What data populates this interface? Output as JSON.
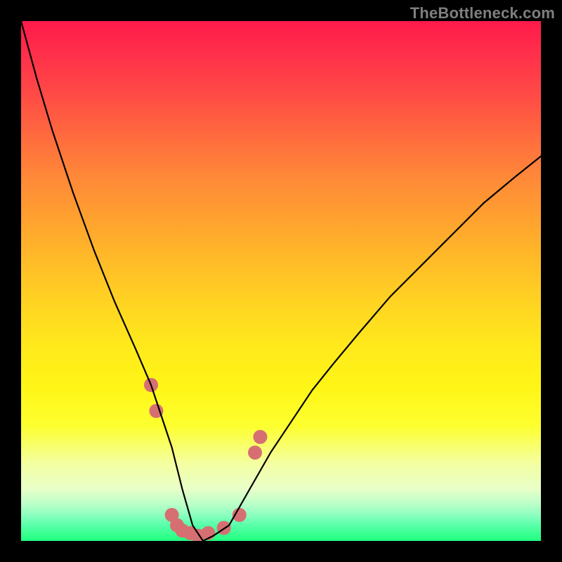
{
  "watermark": "TheBottleneck.com",
  "colors": {
    "background": "#000000",
    "line": "#000000",
    "marker": "#d66f72"
  },
  "chart_data": {
    "type": "line",
    "title": "",
    "xlabel": "",
    "ylabel": "",
    "ylim": [
      0,
      100
    ],
    "series": [
      {
        "name": "curve",
        "x": [
          0,
          3,
          6,
          10,
          14,
          18,
          22,
          25,
          27,
          29,
          31,
          33,
          35,
          37,
          40,
          44,
          48,
          52,
          56,
          60,
          65,
          71,
          77,
          83,
          89,
          95,
          100
        ],
        "values": [
          100,
          89,
          79,
          67,
          56,
          46,
          37,
          30,
          24,
          18,
          10,
          3,
          0,
          1,
          3,
          10,
          17,
          23,
          29,
          34,
          40,
          47,
          53,
          59,
          65,
          70,
          74
        ]
      }
    ],
    "markers": [
      {
        "x": 25,
        "y": 30
      },
      {
        "x": 26,
        "y": 25
      },
      {
        "x": 29,
        "y": 5
      },
      {
        "x": 30,
        "y": 3
      },
      {
        "x": 31,
        "y": 2
      },
      {
        "x": 32.5,
        "y": 1.5
      },
      {
        "x": 34,
        "y": 1
      },
      {
        "x": 36,
        "y": 1.5
      },
      {
        "x": 39,
        "y": 2.5
      },
      {
        "x": 42,
        "y": 5
      },
      {
        "x": 45,
        "y": 17
      },
      {
        "x": 46,
        "y": 20
      }
    ]
  }
}
